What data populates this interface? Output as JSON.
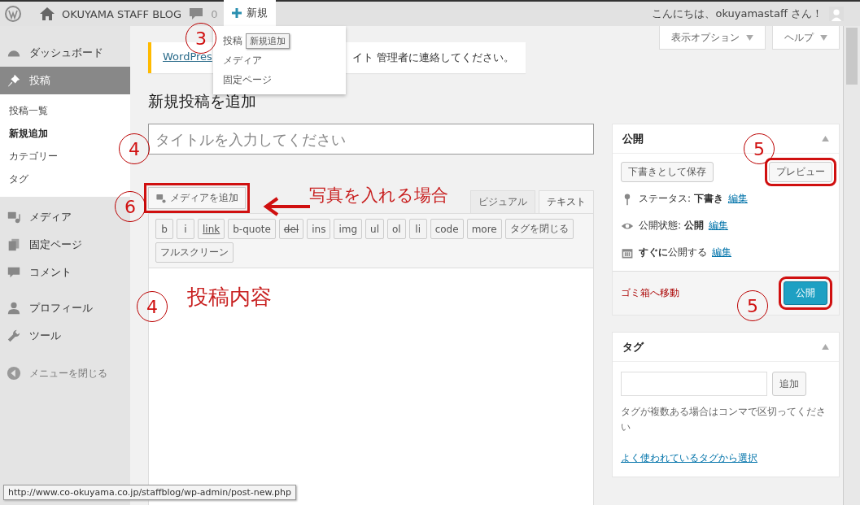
{
  "admin_bar": {
    "site_name": "OKUYAMA STAFF BLOG",
    "comments": "0",
    "new_label": "新規",
    "greeting": "こんにちは、okuyamastaff さん！",
    "new_menu": [
      {
        "label": "投稿",
        "tooltip": "新規追加"
      },
      {
        "label": "メディア"
      },
      {
        "label": "固定ページ"
      }
    ]
  },
  "sidebar": {
    "items": [
      {
        "label": "ダッシュボード",
        "kind": "dashboard",
        "selected": false
      },
      {
        "label": "投稿",
        "kind": "pin",
        "selected": true,
        "children": [
          {
            "label": "投稿一覧",
            "selected": false
          },
          {
            "label": "新規追加",
            "selected": true
          },
          {
            "label": "カテゴリー",
            "selected": false
          },
          {
            "label": "タグ",
            "selected": false
          }
        ]
      },
      {
        "label": "メディア",
        "kind": "media",
        "selected": false
      },
      {
        "label": "固定ページ",
        "kind": "pages",
        "selected": false
      },
      {
        "label": "コメント",
        "kind": "comment",
        "selected": false
      },
      {
        "label": "プロフィール",
        "kind": "user",
        "selected": false
      },
      {
        "label": "ツール",
        "kind": "wrench",
        "selected": false
      }
    ],
    "collapse": "メニューを閉じる"
  },
  "screen_tabs": [
    "表示オプション",
    "ヘルプ"
  ],
  "notice": {
    "link": "WordPres",
    "text": "イト 管理者に連絡してください。"
  },
  "heading": "新規投稿を追加",
  "title_field": {
    "placeholder": "タイトルを入力してください"
  },
  "editor": {
    "media_button": "メディアを追加",
    "tabs": [
      {
        "label": "ビジュアル",
        "selected": false
      },
      {
        "label": "テキスト",
        "selected": true
      }
    ],
    "quicktags": [
      {
        "label": "b",
        "kind": "plain"
      },
      {
        "label": "i",
        "kind": "plain"
      },
      {
        "label": "link",
        "kind": "link"
      },
      {
        "label": "b-quote",
        "kind": "plain"
      },
      {
        "label": "del",
        "kind": "del"
      },
      {
        "label": "ins",
        "kind": "plain"
      },
      {
        "label": "img",
        "kind": "plain"
      },
      {
        "label": "ul",
        "kind": "plain"
      },
      {
        "label": "ol",
        "kind": "plain"
      },
      {
        "label": "li",
        "kind": "plain"
      },
      {
        "label": "code",
        "kind": "plain"
      },
      {
        "label": "more",
        "kind": "plain"
      },
      {
        "label": "タグを閉じる",
        "kind": "plain"
      },
      {
        "label": "フルスクリーン",
        "kind": "plain"
      }
    ]
  },
  "publish_box": {
    "title": "公開",
    "save_draft": "下書きとして保存",
    "preview": "プレビュー",
    "rows": [
      {
        "kind": "pin",
        "text": "ステータス: **下書き**",
        "edit": "編集"
      },
      {
        "kind": "eye",
        "text": "公開状態: **公開**",
        "edit": "編集"
      },
      {
        "kind": "calendar",
        "text": "**すぐに**公開する",
        "edit": "編集"
      }
    ],
    "trash": "ゴミ箱へ移動",
    "publish": "公開"
  },
  "tags_box": {
    "title": "タグ",
    "add": "追加",
    "hint": "タグが複数ある場合はコンマで区切ってください",
    "link": "よく使われているタグから選択"
  },
  "status_url": "http://www.co-okuyama.co.jp/staffblog/wp-admin/post-new.php",
  "annotations": {
    "markers": [
      "3",
      "4",
      "5",
      "6",
      "4",
      "5"
    ],
    "notes": [
      "写真を入れる場合",
      "投稿内容"
    ]
  }
}
